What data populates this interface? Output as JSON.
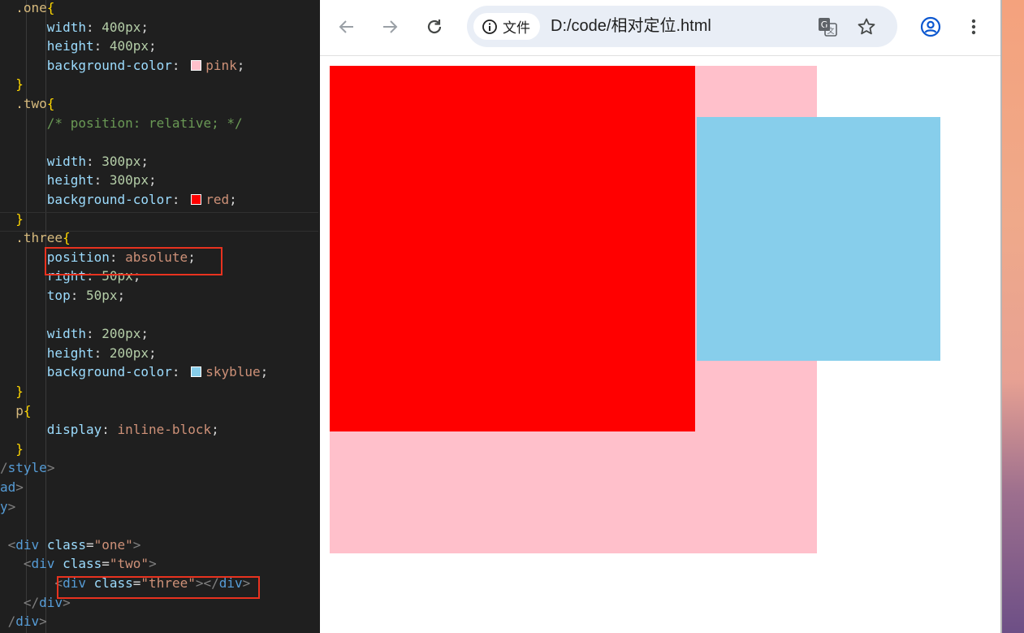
{
  "editor": {
    "lines": [
      [
        {
          "c": "t-sel",
          "t": "  .one"
        },
        {
          "c": "t-brace",
          "t": "{"
        }
      ],
      [
        {
          "c": "t-punc",
          "t": "      "
        },
        {
          "c": "t-prop",
          "t": "width"
        },
        {
          "c": "t-punc",
          "t": ": "
        },
        {
          "c": "t-num",
          "t": "400px"
        },
        {
          "c": "t-punc",
          "t": ";"
        }
      ],
      [
        {
          "c": "t-punc",
          "t": "      "
        },
        {
          "c": "t-prop",
          "t": "height"
        },
        {
          "c": "t-punc",
          "t": ": "
        },
        {
          "c": "t-num",
          "t": "400px"
        },
        {
          "c": "t-punc",
          "t": ";"
        }
      ],
      [
        {
          "c": "t-punc",
          "t": "      "
        },
        {
          "c": "t-prop",
          "t": "background-color"
        },
        {
          "c": "t-punc",
          "t": ": "
        },
        {
          "swatch": "#ffc0cb"
        },
        {
          "c": "t-val",
          "t": "pink"
        },
        {
          "c": "t-punc",
          "t": ";"
        }
      ],
      [
        {
          "c": "t-brace",
          "t": "  }"
        }
      ],
      [
        {
          "c": "t-sel",
          "t": "  .two"
        },
        {
          "c": "t-brace",
          "t": "{"
        }
      ],
      [
        {
          "c": "t-punc",
          "t": "      "
        },
        {
          "c": "t-com",
          "t": "/* position: relative; */"
        }
      ],
      [
        {
          "c": "t-punc",
          "t": ""
        }
      ],
      [
        {
          "c": "t-punc",
          "t": "      "
        },
        {
          "c": "t-prop",
          "t": "width"
        },
        {
          "c": "t-punc",
          "t": ": "
        },
        {
          "c": "t-num",
          "t": "300px"
        },
        {
          "c": "t-punc",
          "t": ";"
        }
      ],
      [
        {
          "c": "t-punc",
          "t": "      "
        },
        {
          "c": "t-prop",
          "t": "height"
        },
        {
          "c": "t-punc",
          "t": ": "
        },
        {
          "c": "t-num",
          "t": "300px"
        },
        {
          "c": "t-punc",
          "t": ";"
        }
      ],
      [
        {
          "c": "t-punc",
          "t": "      "
        },
        {
          "c": "t-prop",
          "t": "background-color"
        },
        {
          "c": "t-punc",
          "t": ": "
        },
        {
          "swatch": "#ff0000"
        },
        {
          "c": "t-val",
          "t": "red"
        },
        {
          "c": "t-punc",
          "t": ";"
        }
      ],
      [
        {
          "c": "t-brace",
          "t": "  }"
        }
      ],
      [
        {
          "c": "t-sel",
          "t": "  .three"
        },
        {
          "c": "t-brace",
          "t": "{"
        }
      ],
      [
        {
          "c": "t-punc",
          "t": "      "
        },
        {
          "c": "t-prop",
          "t": "position"
        },
        {
          "c": "t-punc",
          "t": ": "
        },
        {
          "c": "t-val",
          "t": "absolute"
        },
        {
          "c": "t-punc",
          "t": ";"
        }
      ],
      [
        {
          "c": "t-punc",
          "t": "      "
        },
        {
          "c": "t-prop",
          "t": "right"
        },
        {
          "c": "t-punc",
          "t": ": "
        },
        {
          "c": "t-num",
          "t": "50px"
        },
        {
          "c": "t-punc",
          "t": ";"
        }
      ],
      [
        {
          "c": "t-punc",
          "t": "      "
        },
        {
          "c": "t-prop",
          "t": "top"
        },
        {
          "c": "t-punc",
          "t": ": "
        },
        {
          "c": "t-num",
          "t": "50px"
        },
        {
          "c": "t-punc",
          "t": ";"
        }
      ],
      [
        {
          "c": "t-punc",
          "t": ""
        }
      ],
      [
        {
          "c": "t-punc",
          "t": "      "
        },
        {
          "c": "t-prop",
          "t": "width"
        },
        {
          "c": "t-punc",
          "t": ": "
        },
        {
          "c": "t-num",
          "t": "200px"
        },
        {
          "c": "t-punc",
          "t": ";"
        }
      ],
      [
        {
          "c": "t-punc",
          "t": "      "
        },
        {
          "c": "t-prop",
          "t": "height"
        },
        {
          "c": "t-punc",
          "t": ": "
        },
        {
          "c": "t-num",
          "t": "200px"
        },
        {
          "c": "t-punc",
          "t": ";"
        }
      ],
      [
        {
          "c": "t-punc",
          "t": "      "
        },
        {
          "c": "t-prop",
          "t": "background-color"
        },
        {
          "c": "t-punc",
          "t": ": "
        },
        {
          "swatch": "#87ceeb"
        },
        {
          "c": "t-val",
          "t": "skyblue"
        },
        {
          "c": "t-punc",
          "t": ";"
        }
      ],
      [
        {
          "c": "t-brace",
          "t": "  }"
        }
      ],
      [
        {
          "c": "t-sel",
          "t": "  p"
        },
        {
          "c": "t-brace",
          "t": "{"
        }
      ],
      [
        {
          "c": "t-punc",
          "t": "      "
        },
        {
          "c": "t-prop",
          "t": "display"
        },
        {
          "c": "t-punc",
          "t": ": "
        },
        {
          "c": "t-val",
          "t": "inline-block"
        },
        {
          "c": "t-punc",
          "t": ";"
        }
      ],
      [
        {
          "c": "t-brace",
          "t": "  }"
        }
      ],
      [
        {
          "c": "t-ang",
          "t": "/"
        },
        {
          "c": "t-tag",
          "t": "style"
        },
        {
          "c": "t-ang",
          "t": ">"
        }
      ],
      [
        {
          "c": "t-tag",
          "t": "ad"
        },
        {
          "c": "t-ang",
          "t": ">"
        }
      ],
      [
        {
          "c": "t-tag",
          "t": "y"
        },
        {
          "c": "t-ang",
          "t": ">"
        }
      ],
      [
        {
          "c": "t-punc",
          "t": ""
        }
      ],
      [
        {
          "c": "t-ang",
          "t": " <"
        },
        {
          "c": "t-tag",
          "t": "div"
        },
        {
          "c": "t-punc",
          "t": " "
        },
        {
          "c": "t-attr",
          "t": "class"
        },
        {
          "c": "t-punc",
          "t": "="
        },
        {
          "c": "t-str",
          "t": "\"one\""
        },
        {
          "c": "t-ang",
          "t": ">"
        }
      ],
      [
        {
          "c": "t-ang",
          "t": "   <"
        },
        {
          "c": "t-tag",
          "t": "div"
        },
        {
          "c": "t-punc",
          "t": " "
        },
        {
          "c": "t-attr",
          "t": "class"
        },
        {
          "c": "t-punc",
          "t": "="
        },
        {
          "c": "t-str",
          "t": "\"two\""
        },
        {
          "c": "t-ang",
          "t": ">"
        }
      ],
      [
        {
          "c": "t-ang",
          "t": "       <"
        },
        {
          "c": "t-tag",
          "t": "div"
        },
        {
          "c": "t-punc",
          "t": " "
        },
        {
          "c": "t-attr",
          "t": "class"
        },
        {
          "c": "t-punc",
          "t": "="
        },
        {
          "c": "t-str",
          "t": "\"three\""
        },
        {
          "c": "t-ang",
          "t": "></"
        },
        {
          "c": "t-tag",
          "t": "div"
        },
        {
          "c": "t-ang",
          "t": ">"
        }
      ],
      [
        {
          "c": "t-ang",
          "t": "   </"
        },
        {
          "c": "t-tag",
          "t": "div"
        },
        {
          "c": "t-ang",
          "t": ">"
        }
      ],
      [
        {
          "c": "t-ang",
          "t": " /"
        },
        {
          "c": "t-tag",
          "t": "div"
        },
        {
          "c": "t-ang",
          "t": ">"
        }
      ]
    ]
  },
  "browser": {
    "chip_label": "文件",
    "url": "D:/code/相对定位.html",
    "icons": [
      "back-arrow-icon",
      "forward-arrow-icon",
      "reload-icon",
      "info-icon",
      "translate-icon",
      "star-icon",
      "profile-icon",
      "menu-dots-icon"
    ]
  },
  "page_boxes": {
    "one_color": "#ffc0cb",
    "two_color": "#ff0000",
    "three_color": "#87ceeb"
  }
}
